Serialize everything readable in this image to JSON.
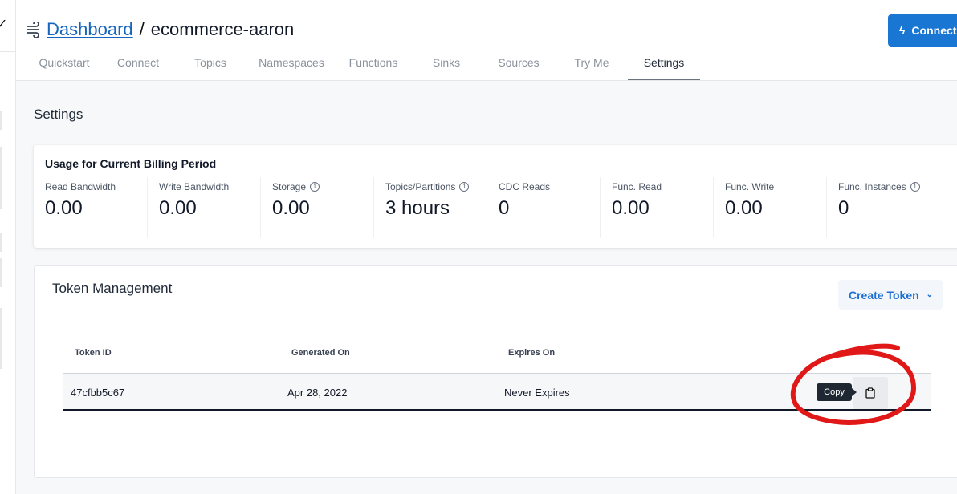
{
  "breadcrumb": {
    "dashboard_link": "Dashboard",
    "separator": "/",
    "current": "ecommerce-aaron"
  },
  "connect_button": {
    "label": "Connect"
  },
  "tabs": [
    {
      "label": "Quickstart"
    },
    {
      "label": "Connect"
    },
    {
      "label": "Topics"
    },
    {
      "label": "Namespaces"
    },
    {
      "label": "Functions"
    },
    {
      "label": "Sinks"
    },
    {
      "label": "Sources"
    },
    {
      "label": "Try Me"
    },
    {
      "label": "Settings"
    }
  ],
  "active_tab": "Settings",
  "page_title": "Settings",
  "usage": {
    "title": "Usage for Current Billing Period",
    "metrics": [
      {
        "label": "Read Bandwidth",
        "value": "0.00",
        "info": false
      },
      {
        "label": "Write Bandwidth",
        "value": "0.00",
        "info": false
      },
      {
        "label": "Storage",
        "value": "0.00",
        "info": true
      },
      {
        "label": "Topics/Partitions",
        "value": "3 hours",
        "info": true
      },
      {
        "label": "CDC Reads",
        "value": "0",
        "info": false
      },
      {
        "label": "Func. Read",
        "value": "0.00",
        "info": false
      },
      {
        "label": "Func. Write",
        "value": "0.00",
        "info": false
      },
      {
        "label": "Func. Instances",
        "value": "0",
        "info": true
      }
    ]
  },
  "tokens": {
    "title": "Token Management",
    "create_button": "Create Token",
    "columns": {
      "token_id": "Token ID",
      "generated_on": "Generated On",
      "expires_on": "Expires On"
    },
    "rows": [
      {
        "token_id": "47cfbb5c67",
        "generated_on": "Apr 28, 2022",
        "expires_on": "Never Expires"
      }
    ],
    "copy_tooltip": "Copy"
  },
  "colors": {
    "accent": "#1976d2",
    "annotation": "#e01818"
  },
  "icons": {
    "breadcrumb": "stream-icon",
    "connect": "bolt-icon",
    "info": "info-icon",
    "copy": "clipboard-icon",
    "dropdown": "chevron-down-icon"
  }
}
